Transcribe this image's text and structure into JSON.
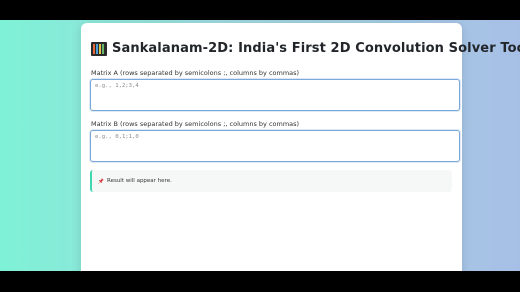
{
  "header": {
    "icon": "abacus-icon",
    "title": "Sankalanam-2D: India's First 2D Convolution Solver Tool"
  },
  "matrix_a": {
    "label": "Matrix A (rows separated by semicolons ;, columns by commas)",
    "placeholder": "e.g., 1,2;3,4",
    "value": ""
  },
  "matrix_b": {
    "label": "Matrix B (rows separated by semicolons ;, columns by commas)",
    "placeholder": "e.g., 0,1;1,0",
    "value": ""
  },
  "result": {
    "icon": "pushpin-icon",
    "text": "Result will appear here."
  },
  "colors": {
    "accent": "#3fd6b0",
    "input_border": "#7aa8d8",
    "gradient_left": "#7ef2d6",
    "gradient_right": "#a7bfe6"
  }
}
